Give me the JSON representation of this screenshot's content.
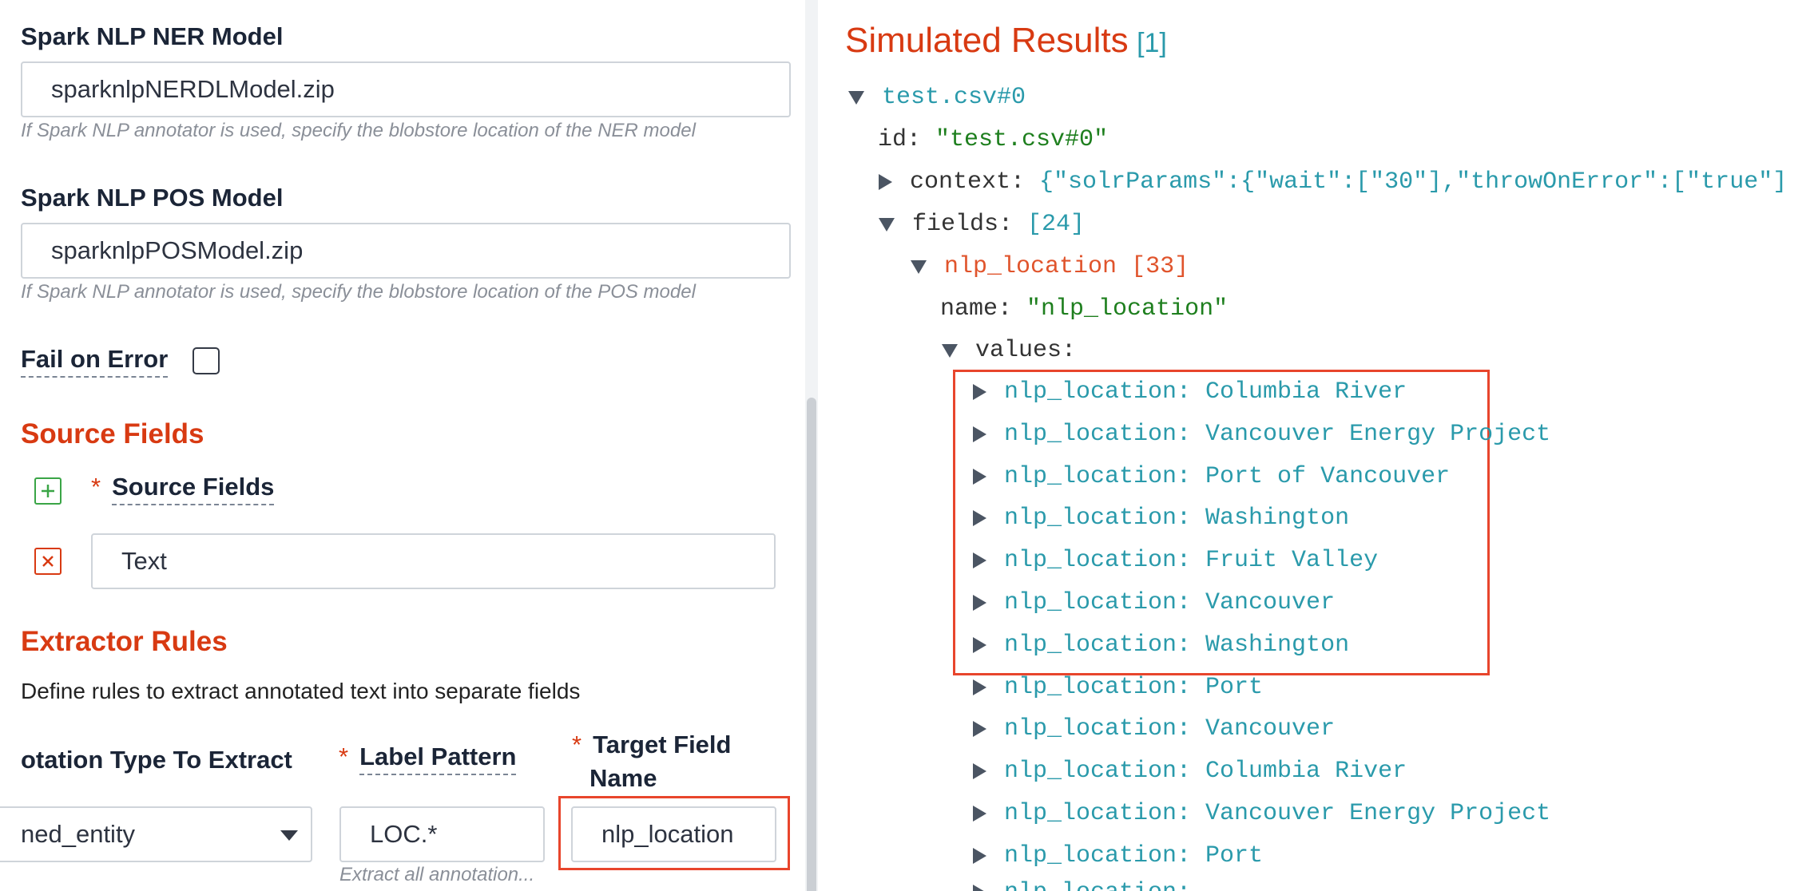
{
  "form": {
    "ner_model": {
      "label": "Spark NLP NER Model",
      "value": "sparknlpNERDLModel.zip",
      "hint": "If Spark NLP annotator is used, specify the blobstore location of the NER model"
    },
    "pos_model": {
      "label": "Spark NLP POS Model",
      "value": "sparknlpPOSModel.zip",
      "hint": "If Spark NLP annotator is used, specify the blobstore location of the POS model"
    },
    "fail_on_error": {
      "label": "Fail on Error",
      "checked": false
    },
    "source_fields": {
      "section_title": "Source Fields",
      "required_mark": "*",
      "column_label": "Source Fields",
      "rows": [
        {
          "value": "Text"
        }
      ]
    },
    "extractor_rules": {
      "section_title": "Extractor Rules",
      "description": "Define rules to extract annotated text into separate fields",
      "columns": {
        "annotation_type": "otation Type To Extract",
        "label_pattern": "Label Pattern",
        "target_field_line1": "Target Field",
        "target_field_line2": "Name"
      },
      "required_mark": "*",
      "row": {
        "annotation_type": "ned_entity",
        "label_pattern": "LOC.*",
        "label_pattern_hint": "Extract all annotation...",
        "target_field": "nlp_location"
      }
    }
  },
  "results": {
    "title": "Simulated Results",
    "count": "[1]",
    "doc_name": "test.csv#0",
    "id_key": "id:",
    "id_value": "\"test.csv#0\"",
    "context_key": "context:",
    "context_value": "{\"solrParams\":{\"wait\":[\"30\"],\"throwOnError\":[\"true\"]",
    "fields_key": "fields:",
    "fields_count": "[24]",
    "field_name": "nlp_location",
    "field_count": "[33]",
    "name_key": "name:",
    "name_value": "\"nlp_location\"",
    "values_key": "values:",
    "values": [
      "nlp_location: Columbia River",
      "nlp_location: Vancouver Energy Project",
      "nlp_location: Port of Vancouver",
      "nlp_location: Washington",
      "nlp_location: Fruit Valley",
      "nlp_location: Vancouver",
      "nlp_location: Washington",
      "nlp_location: Port",
      "nlp_location: Vancouver",
      "nlp_location: Columbia River",
      "nlp_location: Vancouver Energy Project",
      "nlp_location: Port",
      "nlp_location: ..."
    ]
  },
  "colors": {
    "accent": "#d83a12",
    "highlight_box": "#e8452c",
    "teal": "#2a9aab",
    "green": "#1e7f1e"
  }
}
